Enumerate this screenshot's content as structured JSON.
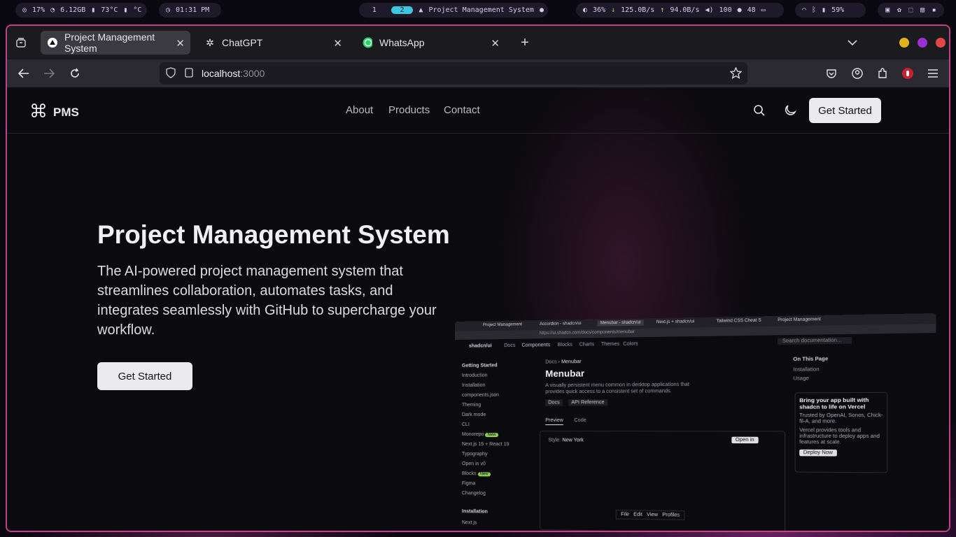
{
  "topbar": {
    "cpu": "17%",
    "ram": "6.12GB",
    "temp": "73°C",
    "temp2": "°C",
    "clock": "01:31 PM",
    "workspaces": [
      "1",
      "2"
    ],
    "window_title": "Project Management System",
    "brightness": "36%",
    "down": "125.0B/s",
    "up": "94.0B/s",
    "volume": "100",
    "mic": "48",
    "battery": "59%"
  },
  "browser": {
    "tabs": [
      {
        "title": "Project Management System",
        "active": true
      },
      {
        "title": "ChatGPT",
        "active": false
      },
      {
        "title": "WhatsApp",
        "active": false
      }
    ],
    "url_host": "localhost",
    "url_port": ":3000"
  },
  "site": {
    "logo": "PMS",
    "nav": [
      "About",
      "Products",
      "Contact"
    ],
    "cta_top": "Get Started",
    "hero_title": "Project Management System",
    "hero_text": "The AI-powered project management system that streamlines collaboration, automates tasks, and integrates seamlessly with GitHub to supercharge your workflow.",
    "cta_hero": "Get Started"
  },
  "preview": {
    "tabs": [
      "Project Management",
      "Accordion - shadcn/ui",
      "Menubar - shadcn/ui",
      "Next.js + shadcn/ui",
      "Tailwind CSS Cheat S",
      "Project Management"
    ],
    "url": "https://ui.shadcn.com/docs/components/menubar",
    "brand": "shadcn/ui",
    "nav": [
      "Docs",
      "Components",
      "Blocks",
      "Charts",
      "Themes",
      "Colors"
    ],
    "search": "Search documentation...",
    "sidebar": [
      "Getting Started",
      "Introduction",
      "Installation",
      "components.json",
      "Theming",
      "Dark mode",
      "CLI",
      "Monorepo",
      "Next.js 15 + React 19",
      "Typography",
      "Open in v0",
      "Blocks",
      "Figma",
      "Changelog",
      "Installation",
      "Next.js"
    ],
    "new_badge": "New",
    "crumb": [
      "Docs",
      "Menubar"
    ],
    "title": "Menubar",
    "desc": "A visually persistent menu common in desktop applications that provides quick access to a consistent set of commands.",
    "links": [
      "Docs",
      "API Reference"
    ],
    "view_tabs": [
      "Preview",
      "Code"
    ],
    "style_label": "Style:",
    "style_value": "New York",
    "open_btn": "Open in",
    "menubar": [
      "File",
      "Edit",
      "View",
      "Profiles"
    ],
    "on_page": "On This Page",
    "on_page_items": [
      "Installation",
      "Usage"
    ],
    "promo_title": "Bring your app built with shadcn to life on Vercel",
    "promo_text1": "Trusted by OpenAI, Sonos, Chick-fil-A, and more.",
    "promo_text2": "Vercel provides tools and infrastructure to deploy apps and features at scale.",
    "promo_btn": "Deploy Now"
  },
  "colors": {
    "accent": "#c53f86",
    "workspace": "#3ec6e0",
    "badge": "#8fd14f"
  }
}
